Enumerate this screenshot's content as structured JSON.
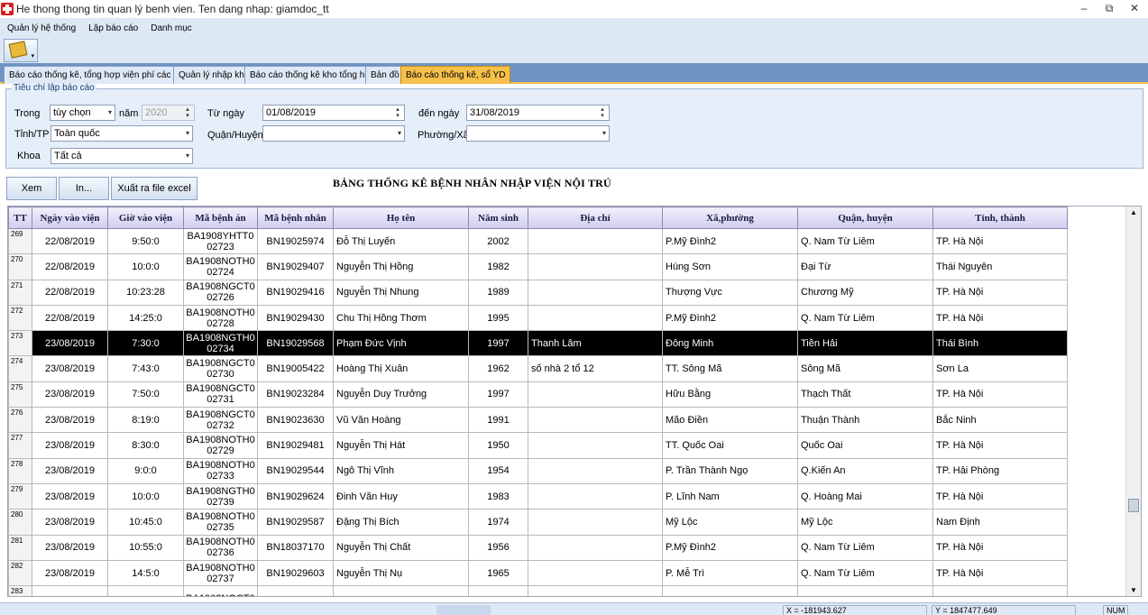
{
  "window": {
    "title": "He thong thong tin quan lý benh vien. Ten dang nhap: giamdoc_tt",
    "minimize": "–",
    "restore": "⧉",
    "close": "✕"
  },
  "menu": [
    "Quản lý hệ thống",
    "Lập báo cáo",
    "Danh mục"
  ],
  "toolbar": {
    "icon": "report-tool-icon",
    "dropdown": "▾"
  },
  "tabs": [
    {
      "label": "Báo cáo thống kê, tổng hợp viện phí các loại",
      "active": false
    },
    {
      "label": "Quản lý nhập kho",
      "active": false
    },
    {
      "label": "Báo cáo thống kê kho tổng hợp",
      "active": false
    },
    {
      "label": "Bản đồ",
      "active": false
    },
    {
      "label": "Báo cáo thống kê, sổ YD",
      "active": true
    }
  ],
  "criteria": {
    "legend": "Tiêu chí lập báo cáo",
    "trong_label": "Trong",
    "trong_value": "tùy chọn",
    "nam_label": "năm",
    "nam_value": "2020",
    "tu_ngay_label": "Từ ngày",
    "tu_ngay_value": "01/08/2019",
    "den_ngay_label": "đến ngày",
    "den_ngay_value": "31/08/2019",
    "tinh_label": "Tỉnh/TP",
    "tinh_value": "Toàn quốc",
    "quan_label": "Quận/Huyện",
    "quan_value": "",
    "phuong_label": "Phường/Xã",
    "phuong_value": "",
    "khoa_label": "Khoa",
    "khoa_value": "Tất cả"
  },
  "actions": {
    "xem": "Xem",
    "in": "In...",
    "excel": "Xuất ra file excel"
  },
  "report_title": "BẢNG THỐNG KÊ BỆNH NHÂN NHẬP VIỆN NỘI TRÚ",
  "table": {
    "columns": [
      "TT",
      "Ngày vào viện",
      "Giờ vào viện",
      "Mã bệnh án",
      "Mã bệnh nhân",
      "Họ tên",
      "Năm sinh",
      "Địa chỉ",
      "Xã,phường",
      "Quận, huyện",
      "Tỉnh, thành"
    ],
    "selected_index": 4,
    "rows": [
      [
        "269",
        "22/08/2019",
        "9:50:0",
        "BA1908YHTT002723",
        "BN19025974",
        "Đỗ Thị Luyến",
        "2002",
        "",
        "P.Mỹ Đình2",
        "Q. Nam Từ Liêm",
        "TP. Hà Nội"
      ],
      [
        "270",
        "22/08/2019",
        "10:0:0",
        "BA1908NOTH002724",
        "BN19029407",
        "Nguyễn Thị Hồng",
        "1982",
        "",
        "Hùng Sơn",
        "Đại Từ",
        "Thái Nguyên"
      ],
      [
        "271",
        "22/08/2019",
        "10:23:28",
        "BA1908NGCT002726",
        "BN19029416",
        "Nguyễn Thị Nhung",
        "1989",
        "",
        "Thượng Vực",
        "Chương Mỹ",
        "TP. Hà Nội"
      ],
      [
        "272",
        "22/08/2019",
        "14:25:0",
        "BA1908NOTH002728",
        "BN19029430",
        "Chu Thị Hồng Thơm",
        "1995",
        "",
        "P.Mỹ Đình2",
        "Q. Nam Từ Liêm",
        "TP. Hà Nội"
      ],
      [
        "273",
        "23/08/2019",
        "7:30:0",
        "BA1908NGTH002734",
        "BN19029568",
        "Phạm Đức Vịnh",
        "1997",
        "Thanh Lâm",
        "Đông Minh",
        "Tiền Hải",
        "Thái Bình"
      ],
      [
        "274",
        "23/08/2019",
        "7:43:0",
        "BA1908NGCT002730",
        "BN19005422",
        "Hoàng Thị Xuân",
        "1962",
        "số nhà 2 tổ 12",
        "TT. Sông Mã",
        "Sông Mã",
        "Sơn La"
      ],
      [
        "275",
        "23/08/2019",
        "7:50:0",
        "BA1908NGCT002731",
        "BN19023284",
        "Nguyễn Duy Trưởng",
        "1997",
        "",
        "Hữu Bằng",
        "Thạch Thất",
        "TP. Hà Nội"
      ],
      [
        "276",
        "23/08/2019",
        "8:19:0",
        "BA1908NGCT002732",
        "BN19023630",
        "Vũ Văn Hoàng",
        "1991",
        "",
        "Mão Điền",
        "Thuận Thành",
        "Bắc Ninh"
      ],
      [
        "277",
        "23/08/2019",
        "8:30:0",
        "BA1908NOTH002729",
        "BN19029481",
        "Nguyễn Thị Hát",
        "1950",
        "",
        "TT. Quốc Oai",
        "Quốc Oai",
        "TP. Hà Nội"
      ],
      [
        "278",
        "23/08/2019",
        "9:0:0",
        "BA1908NOTH002733",
        "BN19029544",
        "Ngô Thị Vĩnh",
        "1954",
        "",
        "P. Trần Thành Ngọ",
        "Q.Kiến An",
        "TP. Hải Phòng"
      ],
      [
        "279",
        "23/08/2019",
        "10:0:0",
        "BA1908NGTH002739",
        "BN19029624",
        "Đinh Văn Huy",
        "1983",
        "",
        "P. Lĩnh Nam",
        "Q. Hoàng Mai",
        "TP. Hà Nội"
      ],
      [
        "280",
        "23/08/2019",
        "10:45:0",
        "BA1908NOTH002735",
        "BN19029587",
        "Đặng Thị Bích",
        "1974",
        "",
        "Mỹ Lộc",
        "Mỹ Lộc",
        "Nam Định"
      ],
      [
        "281",
        "23/08/2019",
        "10:55:0",
        "BA1908NOTH002736",
        "BN18037170",
        "Nguyễn Thị Chất",
        "1956",
        "",
        "P.Mỹ Đình2",
        "Q. Nam Từ Liêm",
        "TP. Hà Nội"
      ],
      [
        "282",
        "23/08/2019",
        "14:5:0",
        "BA1908NOTH002737",
        "BN19029603",
        "Nguyễn Thị Nụ",
        "1965",
        "",
        "P. Mễ Trì",
        "Q. Nam Từ Liêm",
        "TP. Hà Nội"
      ],
      [
        "283",
        "",
        "",
        "BA1908NGCT0",
        "",
        "",
        "",
        "",
        "",
        "",
        ""
      ]
    ]
  },
  "statusbar": {
    "x": "X = -181943.627",
    "y": "Y = 1847477.649",
    "num": "NUM"
  }
}
